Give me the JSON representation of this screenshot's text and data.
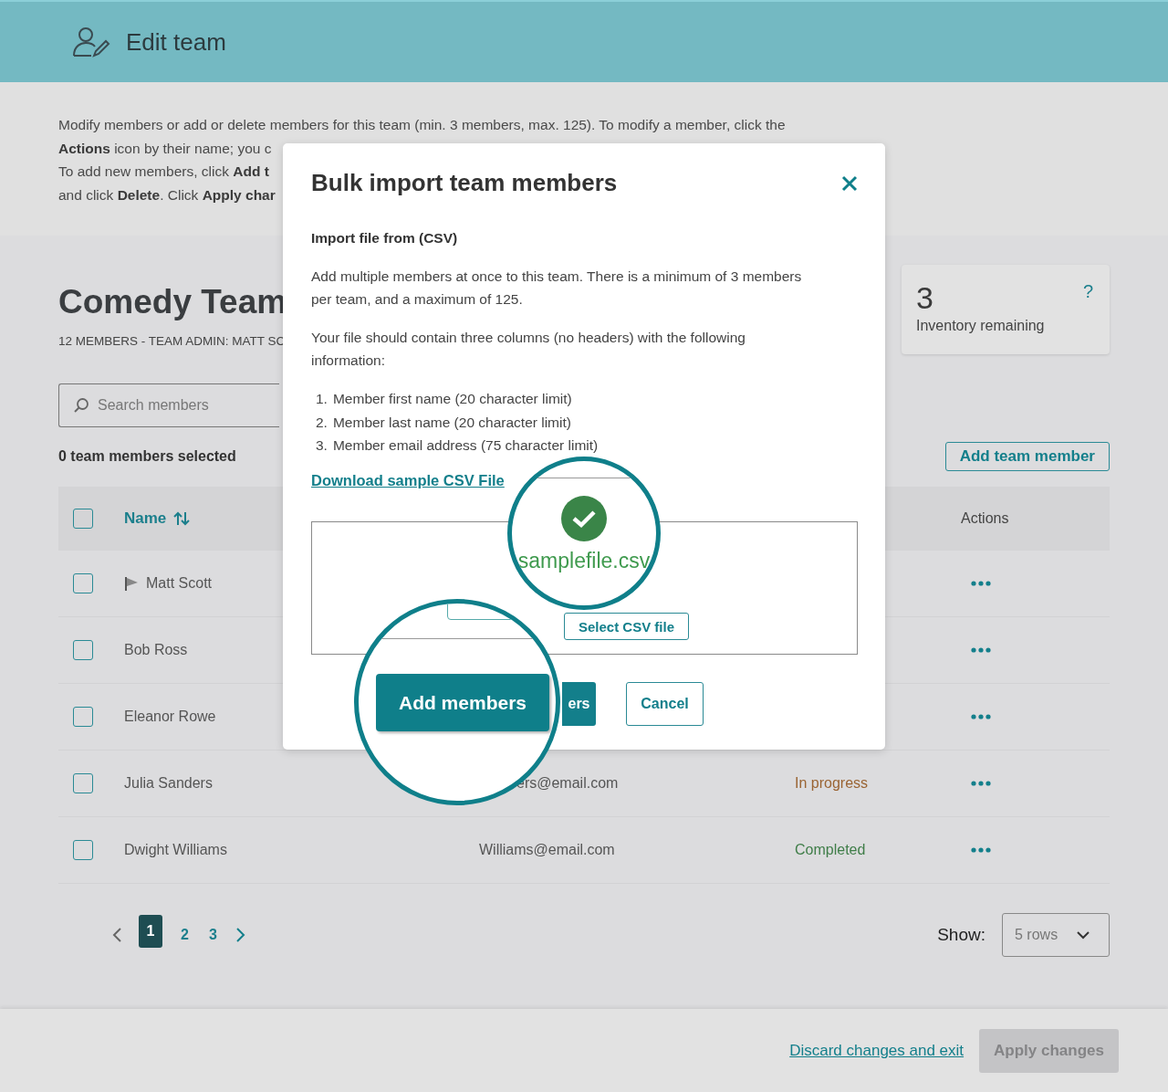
{
  "header": {
    "title": "Edit team"
  },
  "intro_lines": [
    "Modify members or add or delete members for this team (min. 3 members, max. 125). To modify a member, click the",
    "**Actions** icon by their name; you c",
    "To add new members, click **Add t**",
    "and click **Delete**. Click **Apply char**"
  ],
  "team": {
    "name": "Comedy Team",
    "subtitle": "12 MEMBERS - TEAM ADMIN: MATT SC"
  },
  "inventory": {
    "count": "3",
    "label": "Inventory remaining",
    "help": "?"
  },
  "search": {
    "placeholder": "Search members"
  },
  "selected_count": "0 team members selected",
  "add_member_button": "Add team member",
  "table": {
    "columns": [
      "Name",
      "Actions"
    ],
    "header_checked": false,
    "rows": [
      {
        "name": "Matt Scott",
        "admin": true,
        "checked": false
      },
      {
        "name": "Bob Ross",
        "admin": false,
        "checked": false
      },
      {
        "name": "Eleanor Rowe",
        "admin": false,
        "checked": false
      },
      {
        "name": "Julia Sanders",
        "admin": false,
        "checked": false,
        "email": "ers@email.com",
        "email_covered": true,
        "status": "In progress",
        "color": "#9a6433"
      },
      {
        "name": "Dwight Williams",
        "admin": false,
        "checked": false,
        "email": "Williams@email.com",
        "status": "Completed",
        "color": "#3f7d48"
      }
    ]
  },
  "pagination": {
    "pages": [
      {
        "label": "1",
        "selected": true
      },
      {
        "label": "2",
        "selected": false
      },
      {
        "label": "3",
        "selected": false
      }
    ]
  },
  "rows_select": {
    "label": "Show:",
    "value": "5 rows"
  },
  "footer": {
    "discard_link": "Discard changes and exit",
    "apply_button": "Apply changes",
    "apply_disabled": true
  },
  "modal": {
    "title": "Bulk import team members",
    "section": "Import file from (CSV)",
    "paragraphs": [
      "Add multiple members at once to this team. There is a minimum of 3 members per team, and a maximum of 125.",
      "Your file should contain three columns (no headers) with the following information:"
    ],
    "list": [
      {
        "number": "1.",
        "text": "Member first name (20 character limit)"
      },
      {
        "number": "2.",
        "text": "Member last name (20 character limit)"
      },
      {
        "number": "3.",
        "text": "Member email address (75 character limit)"
      }
    ],
    "download_link": "Download sample CSV File",
    "select_button": "Select CSV file",
    "primary_fragment": "ers",
    "cancel_button": "Cancel"
  },
  "magnifiers": {
    "file_name": "samplefile.csv",
    "add_button": "Add members"
  }
}
